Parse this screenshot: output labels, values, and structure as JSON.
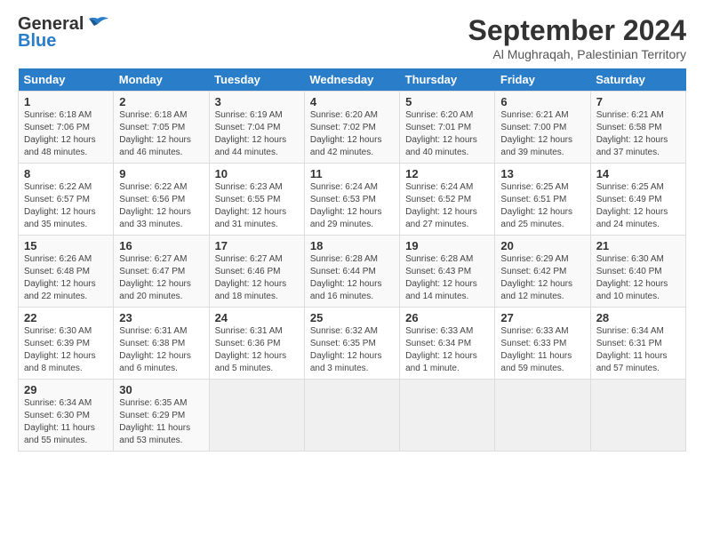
{
  "logo": {
    "line1": "General",
    "line2": "Blue"
  },
  "title": "September 2024",
  "subtitle": "Al Mughraqah, Palestinian Territory",
  "headers": [
    "Sunday",
    "Monday",
    "Tuesday",
    "Wednesday",
    "Thursday",
    "Friday",
    "Saturday"
  ],
  "weeks": [
    [
      {
        "day": "1",
        "info": "Sunrise: 6:18 AM\nSunset: 7:06 PM\nDaylight: 12 hours\nand 48 minutes."
      },
      {
        "day": "2",
        "info": "Sunrise: 6:18 AM\nSunset: 7:05 PM\nDaylight: 12 hours\nand 46 minutes."
      },
      {
        "day": "3",
        "info": "Sunrise: 6:19 AM\nSunset: 7:04 PM\nDaylight: 12 hours\nand 44 minutes."
      },
      {
        "day": "4",
        "info": "Sunrise: 6:20 AM\nSunset: 7:02 PM\nDaylight: 12 hours\nand 42 minutes."
      },
      {
        "day": "5",
        "info": "Sunrise: 6:20 AM\nSunset: 7:01 PM\nDaylight: 12 hours\nand 40 minutes."
      },
      {
        "day": "6",
        "info": "Sunrise: 6:21 AM\nSunset: 7:00 PM\nDaylight: 12 hours\nand 39 minutes."
      },
      {
        "day": "7",
        "info": "Sunrise: 6:21 AM\nSunset: 6:58 PM\nDaylight: 12 hours\nand 37 minutes."
      }
    ],
    [
      {
        "day": "8",
        "info": "Sunrise: 6:22 AM\nSunset: 6:57 PM\nDaylight: 12 hours\nand 35 minutes."
      },
      {
        "day": "9",
        "info": "Sunrise: 6:22 AM\nSunset: 6:56 PM\nDaylight: 12 hours\nand 33 minutes."
      },
      {
        "day": "10",
        "info": "Sunrise: 6:23 AM\nSunset: 6:55 PM\nDaylight: 12 hours\nand 31 minutes."
      },
      {
        "day": "11",
        "info": "Sunrise: 6:24 AM\nSunset: 6:53 PM\nDaylight: 12 hours\nand 29 minutes."
      },
      {
        "day": "12",
        "info": "Sunrise: 6:24 AM\nSunset: 6:52 PM\nDaylight: 12 hours\nand 27 minutes."
      },
      {
        "day": "13",
        "info": "Sunrise: 6:25 AM\nSunset: 6:51 PM\nDaylight: 12 hours\nand 25 minutes."
      },
      {
        "day": "14",
        "info": "Sunrise: 6:25 AM\nSunset: 6:49 PM\nDaylight: 12 hours\nand 24 minutes."
      }
    ],
    [
      {
        "day": "15",
        "info": "Sunrise: 6:26 AM\nSunset: 6:48 PM\nDaylight: 12 hours\nand 22 minutes."
      },
      {
        "day": "16",
        "info": "Sunrise: 6:27 AM\nSunset: 6:47 PM\nDaylight: 12 hours\nand 20 minutes."
      },
      {
        "day": "17",
        "info": "Sunrise: 6:27 AM\nSunset: 6:46 PM\nDaylight: 12 hours\nand 18 minutes."
      },
      {
        "day": "18",
        "info": "Sunrise: 6:28 AM\nSunset: 6:44 PM\nDaylight: 12 hours\nand 16 minutes."
      },
      {
        "day": "19",
        "info": "Sunrise: 6:28 AM\nSunset: 6:43 PM\nDaylight: 12 hours\nand 14 minutes."
      },
      {
        "day": "20",
        "info": "Sunrise: 6:29 AM\nSunset: 6:42 PM\nDaylight: 12 hours\nand 12 minutes."
      },
      {
        "day": "21",
        "info": "Sunrise: 6:30 AM\nSunset: 6:40 PM\nDaylight: 12 hours\nand 10 minutes."
      }
    ],
    [
      {
        "day": "22",
        "info": "Sunrise: 6:30 AM\nSunset: 6:39 PM\nDaylight: 12 hours\nand 8 minutes."
      },
      {
        "day": "23",
        "info": "Sunrise: 6:31 AM\nSunset: 6:38 PM\nDaylight: 12 hours\nand 6 minutes."
      },
      {
        "day": "24",
        "info": "Sunrise: 6:31 AM\nSunset: 6:36 PM\nDaylight: 12 hours\nand 5 minutes."
      },
      {
        "day": "25",
        "info": "Sunrise: 6:32 AM\nSunset: 6:35 PM\nDaylight: 12 hours\nand 3 minutes."
      },
      {
        "day": "26",
        "info": "Sunrise: 6:33 AM\nSunset: 6:34 PM\nDaylight: 12 hours\nand 1 minute."
      },
      {
        "day": "27",
        "info": "Sunrise: 6:33 AM\nSunset: 6:33 PM\nDaylight: 11 hours\nand 59 minutes."
      },
      {
        "day": "28",
        "info": "Sunrise: 6:34 AM\nSunset: 6:31 PM\nDaylight: 11 hours\nand 57 minutes."
      }
    ],
    [
      {
        "day": "29",
        "info": "Sunrise: 6:34 AM\nSunset: 6:30 PM\nDaylight: 11 hours\nand 55 minutes."
      },
      {
        "day": "30",
        "info": "Sunrise: 6:35 AM\nSunset: 6:29 PM\nDaylight: 11 hours\nand 53 minutes."
      },
      {
        "day": "",
        "info": ""
      },
      {
        "day": "",
        "info": ""
      },
      {
        "day": "",
        "info": ""
      },
      {
        "day": "",
        "info": ""
      },
      {
        "day": "",
        "info": ""
      }
    ]
  ]
}
